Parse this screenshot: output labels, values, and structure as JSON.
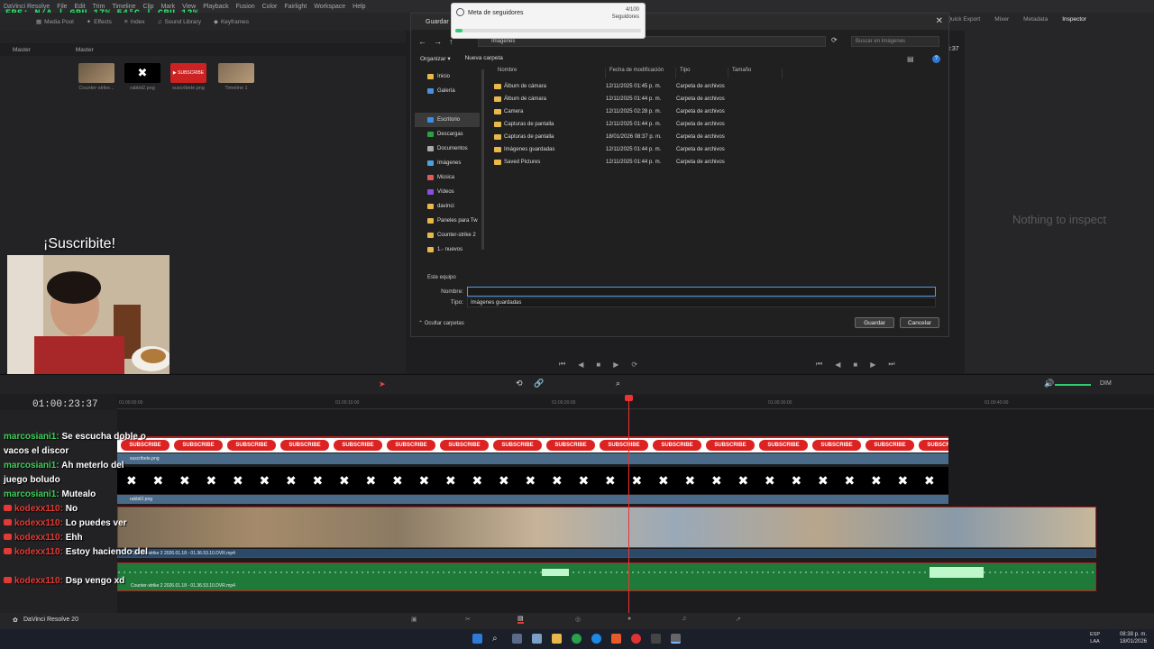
{
  "app": {
    "title": "DaVinci Resolve",
    "version_label": "DaVinci Resolve 20"
  },
  "menu": [
    "File",
    "Edit",
    "Trim",
    "Timeline",
    "Clip",
    "Mark",
    "View",
    "Playback",
    "Fusion",
    "Color",
    "Fairlight",
    "Workspace",
    "Help"
  ],
  "overlay_stats": "FPS: N/A | GPU 17% 54°C | CPU 12%",
  "toolbar": {
    "media_pool": "Media Pool",
    "effects": "Effects",
    "index": "Index",
    "sound_library": "Sound Library",
    "keyframes": "Keyframes",
    "quick_export": "Quick Export",
    "mixer": "Mixer",
    "metadata": "Metadata",
    "inspector": "Inspector"
  },
  "media": {
    "bin_left": "Master",
    "bin_right": "Master",
    "items": [
      "Counter-strike...",
      "rabbit2.png",
      "suscribete.png",
      "Timeline 1"
    ]
  },
  "inspector": {
    "empty": "Nothing to inspect",
    "time_right": "3:37"
  },
  "overlay_title": "¡Suscribite!",
  "dialog": {
    "title": "Guardar como",
    "address": "Imágenes",
    "search_placeholder": "Buscar en Imágenes",
    "organize": "Organizar ▾",
    "new_folder": "Nueva carpeta",
    "nav": [
      {
        "label": "Inicio",
        "color": "#e8b84a"
      },
      {
        "label": "Galería",
        "color": "#4a90e2"
      },
      {
        "label": "Escritorio",
        "color": "#3a8ee6"
      },
      {
        "label": "Descargas",
        "color": "#2ea043"
      },
      {
        "label": "Documentos",
        "color": "#aaaaaa"
      },
      {
        "label": "Imágenes",
        "color": "#4aa3df"
      },
      {
        "label": "Música",
        "color": "#e05a5a"
      },
      {
        "label": "Vídeos",
        "color": "#8a4fe0"
      },
      {
        "label": "davinci",
        "color": "#e8b84a"
      },
      {
        "label": "Paneles para Tw",
        "color": "#e8b84a"
      },
      {
        "label": "Counter-strike 2",
        "color": "#e8b84a"
      },
      {
        "label": "1.- nuevos",
        "color": "#e8b84a"
      }
    ],
    "nav_more": "Este equipo",
    "columns": [
      "Nombre",
      "Fecha de modificación",
      "Tipo",
      "Tamaño"
    ],
    "rows": [
      {
        "name": "Álbum de cámara",
        "date": "12/11/2025 01:45 p. m.",
        "type": "Carpeta de archivos"
      },
      {
        "name": "Álbum de cámara",
        "date": "12/11/2025 01:44 p. m.",
        "type": "Carpeta de archivos"
      },
      {
        "name": "Camera",
        "date": "12/11/2025 02:28 p. m.",
        "type": "Carpeta de archivos"
      },
      {
        "name": "Capturas de pantalla",
        "date": "12/11/2025 01:44 p. m.",
        "type": "Carpeta de archivos"
      },
      {
        "name": "Capturas de pantalla",
        "date": "18/01/2026 08:37 p. m.",
        "type": "Carpeta de archivos"
      },
      {
        "name": "Imágenes guardadas",
        "date": "12/11/2025 01:44 p. m.",
        "type": "Carpeta de archivos"
      },
      {
        "name": "Saved Pictures",
        "date": "12/11/2025 01:44 p. m.",
        "type": "Carpeta de archivos"
      }
    ],
    "filename_label": "Nombre:",
    "filename_value": "",
    "type_label": "Tipo:",
    "type_value": "Imágenes guardadas",
    "hide_folders": "Ocultar carpetas",
    "save": "Guardar",
    "cancel": "Cancelar"
  },
  "notification": {
    "title": "Meta de seguidores",
    "count": "4/100",
    "unit": "Seguidores",
    "progress": 0.04
  },
  "timeline": {
    "timecode": "01:00:23:37",
    "ruler": [
      "01:00:00:00",
      "01:00:10:00",
      "01:00:20:00",
      "01:00:30:00",
      "01:00:40:00"
    ],
    "clips": {
      "sub": "suscribete.png",
      "rabbit": "rabbit2.png",
      "video": "Counter-strike 2 2026.01.18 - 01.36.53.10.DVR.mp4",
      "audio": "Counter-strike 2 2026.01.18 - 01.36.53.10.DVR.mp4"
    },
    "subscribe_text": "SUBSCRIBE",
    "dim": "DIM"
  },
  "chat": [
    {
      "user": "marcosiani1:",
      "msg": "Se escucha doble o",
      "kind": "u"
    },
    {
      "user": "",
      "msg": "vacos el discor",
      "kind": "u"
    },
    {
      "user": "marcosiani1:",
      "msg": "Ah   meterlo   del",
      "kind": "u"
    },
    {
      "user": "",
      "msg": "juego boludo",
      "kind": "u"
    },
    {
      "user": "marcosiani1:",
      "msg": "Mutealo",
      "kind": "u"
    },
    {
      "user": "kodexx110:",
      "msg": "No",
      "kind": "k"
    },
    {
      "user": "kodexx110:",
      "msg": "Lo puedes ver",
      "kind": "k"
    },
    {
      "user": "kodexx110:",
      "msg": "Ehh",
      "kind": "k"
    },
    {
      "user": "kodexx110:",
      "msg": "Estoy haciendo del",
      "kind": "k"
    },
    {
      "user": "",
      "msg": "",
      "kind": "k"
    },
    {
      "user": "kodexx110:",
      "msg": "Dsp vengo xd",
      "kind": "k"
    }
  ],
  "taskbar": {
    "lang": "ESP",
    "lang2": "LAA",
    "time": "08:38 p. m.",
    "date": "18/01/2026"
  }
}
